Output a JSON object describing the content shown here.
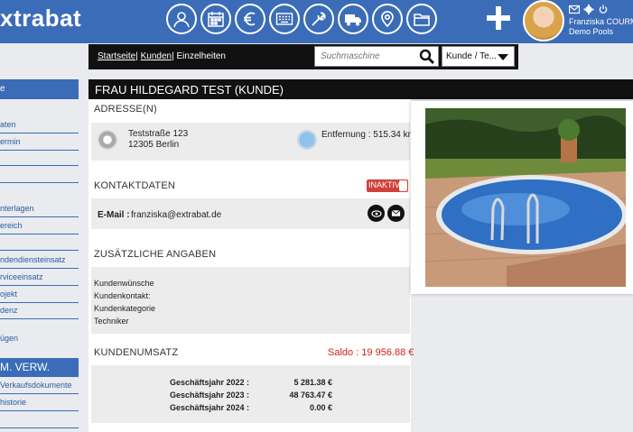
{
  "header": {
    "logo_text": "xtrabat",
    "nav_icons": [
      "user-icon",
      "calendar-icon",
      "euro-icon",
      "keyboard-icon",
      "wrench-icon",
      "truck-icon",
      "location-pin-icon",
      "folder-icon"
    ],
    "user": {
      "name": "Franziska COURMO",
      "company": "Demo Pools"
    }
  },
  "breadcrumb": {
    "home": "Startseite",
    "customers": "Kunden",
    "current": "Einzelheiten",
    "sep": "|"
  },
  "search": {
    "placeholder": "Suchmaschine",
    "select_value": "Kunde / Te..."
  },
  "sidebar": {
    "items_top": [
      {
        "label": "e"
      },
      {
        "label": "aten"
      },
      {
        "label": "ermin"
      }
    ],
    "items_mid": [
      {
        "label": "nterlagen"
      },
      {
        "label": "ereich"
      }
    ],
    "items_low": [
      {
        "label": "ndendiensteinsatz"
      },
      {
        "label": "rviceeinsatz"
      },
      {
        "label": "ojekt"
      },
      {
        "label": "denz"
      }
    ],
    "extra": "ügen",
    "section_header": "M. VERW.",
    "items_bottom": [
      {
        "label": "Verkaufsdokumente"
      },
      {
        "label": "historie"
      }
    ]
  },
  "customer": {
    "title": "FRAU HILDEGARD TEST (KUNDE)",
    "address_heading": "ADRESSE(N)",
    "street": "Teststraße 123",
    "city": "12305 Berlin",
    "distance": "Entfernung : 515.34 km",
    "contact_heading": "KONTAKTDATEN",
    "status_badge": "INAKTIV",
    "email_label": "E-Mail :",
    "email": "franziska@extrabat.de",
    "extra_heading": "ZUSÄTZLICHE ANGABEN",
    "extra_fields": [
      "Kundenwünsche",
      "Kundenkontakt:",
      "Kundenkategorie",
      "Techniker"
    ],
    "revenue_heading": "KUNDENUMSATZ",
    "saldo": "Saldo : 19 956.88 €",
    "fiscal_years": [
      {
        "label": "Geschäftsjahr 2022 :",
        "value": "5 281.38 €"
      },
      {
        "label": "Geschäftsjahr 2023 :",
        "value": "48 763.47 €"
      },
      {
        "label": "Geschäftsjahr 2024 :",
        "value": "0.00 €"
      }
    ]
  },
  "colors": {
    "brand_blue": "#3b6cb8",
    "saldo_red": "#d0221a",
    "badge_red": "#d0413a"
  }
}
